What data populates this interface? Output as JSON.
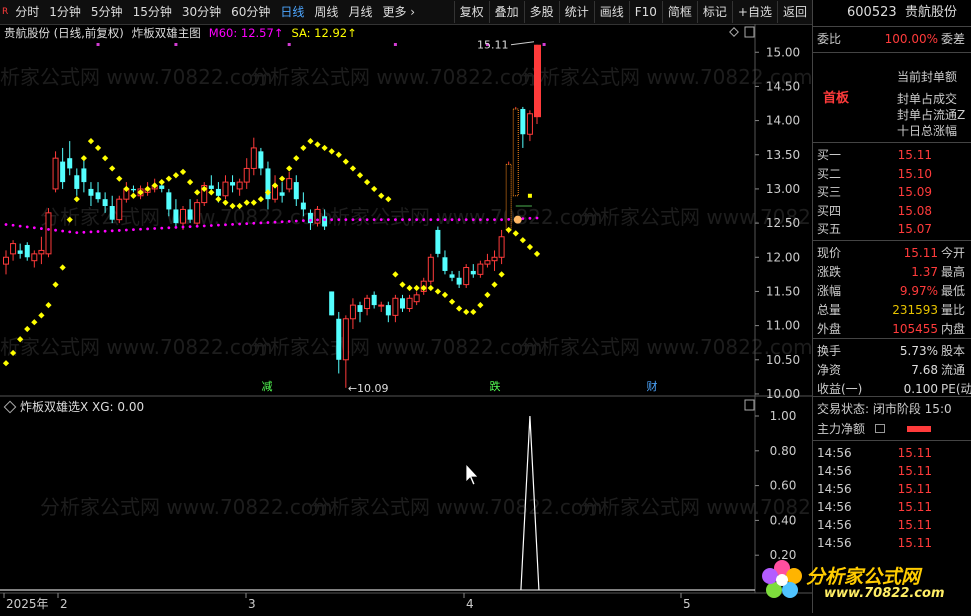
{
  "toolbar": {
    "r_marker": "R",
    "items": [
      "分时",
      "1分钟",
      "5分钟",
      "15分钟",
      "30分钟",
      "60分钟",
      "日线",
      "周线",
      "月线",
      "更多 ›"
    ],
    "active_index": 6,
    "right_items": [
      "复权",
      "叠加",
      "多股",
      "统计",
      "画线",
      "F10",
      "简框",
      "标记",
      "+自选",
      "返回"
    ]
  },
  "indicator_line": {
    "stock": "贵航股份 (日线,前复权)",
    "formula": "炸板双雄主图",
    "m60": "M60: 12.57↑",
    "sa": "SA: 12.92↑"
  },
  "sub_indicator": {
    "label": "炸板双雄选X XG: 0.00"
  },
  "annotations": {
    "high": "15.11",
    "low": "←10.09",
    "sig1": "减",
    "sig2": "跌",
    "sig3": "财"
  },
  "main_axis": [
    "15.00",
    "14.50",
    "14.00",
    "13.50",
    "13.00",
    "12.50",
    "12.00",
    "11.50",
    "11.00",
    "10.50",
    "10.00"
  ],
  "sub_axis": [
    "1.00",
    "0.80",
    "0.60",
    "0.40",
    "0.20"
  ],
  "date_axis": [
    "2025年",
    "2",
    "3",
    "4",
    "5"
  ],
  "watermark": "分析家公式网 www.70822.com",
  "colors": {
    "up": "#ff3b3b",
    "down": "#54ffff",
    "sar": "#ffff00",
    "ma": "#ff00ff",
    "bg": "#000000"
  },
  "panel": {
    "code": "600523",
    "name": "贵航股份",
    "weibi": {
      "label": "委比",
      "value": "100.00%",
      "label2": "委差"
    },
    "board": "首板",
    "info_lines": [
      "当前封单额",
      "封单占成交",
      "封单占流通Z",
      "十日总涨幅"
    ],
    "buys": [
      {
        "label": "买一",
        "price": "15.11"
      },
      {
        "label": "买二",
        "price": "15.10"
      },
      {
        "label": "买三",
        "price": "15.09"
      },
      {
        "label": "买四",
        "price": "15.08"
      },
      {
        "label": "买五",
        "price": "15.07"
      }
    ],
    "quote": [
      {
        "label": "现价",
        "value": "15.11",
        "color": "red",
        "label2": "今开"
      },
      {
        "label": "涨跌",
        "value": "1.37",
        "color": "red",
        "label2": "最高"
      },
      {
        "label": "涨幅",
        "value": "9.97%",
        "color": "red",
        "label2": "最低"
      },
      {
        "label": "总量",
        "value": "231593",
        "color": "yellow",
        "label2": "量比"
      },
      {
        "label": "外盘",
        "value": "105455",
        "color": "red",
        "label2": "内盘"
      }
    ],
    "stats": [
      {
        "label": "换手",
        "value": "5.73%",
        "label2": "股本"
      },
      {
        "label": "净资",
        "value": "7.68",
        "label2": "流通"
      },
      {
        "label": "收益(一)",
        "value": "0.100",
        "label2": "PE(动"
      }
    ],
    "trade_state": "交易状态: 闭市阶段 15:0",
    "main_flow": "主力净额",
    "ticks": [
      {
        "time": "14:56",
        "price": "15.11"
      },
      {
        "time": "14:56",
        "price": "15.11"
      },
      {
        "time": "14:56",
        "price": "15.11"
      },
      {
        "time": "14:56",
        "price": "15.11"
      },
      {
        "time": "14:56",
        "price": "15.11"
      },
      {
        "time": "14:56",
        "price": "15.11"
      }
    ]
  },
  "logo": {
    "title": "分析家公式网",
    "url": "www.70822.com"
  }
}
